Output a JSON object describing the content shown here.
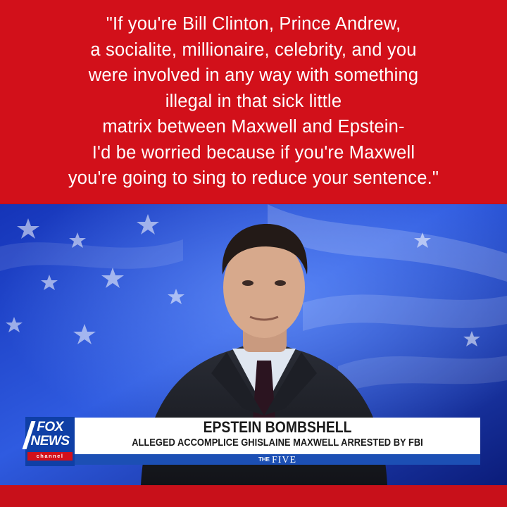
{
  "quote": {
    "text": "\"If you're Bill Clinton, Prince Andrew,\na socialite, millionaire, celebrity, and you\nwere involved in any way with something\nillegal in that sick little\nmatrix between Maxwell and Epstein-\nI'd be worried because if you're Maxwell\nyou're going to sing to reduce your sentence.\""
  },
  "logo": {
    "line1": "FOX",
    "line2": "NEWS",
    "line3": "channel"
  },
  "chyron": {
    "headline": "EPSTEIN BOMBSHELL",
    "subhead": "ALLEGED ACCOMPLICE GHISLAINE MAXWELL ARRESTED BY FBI"
  },
  "show": {
    "the": "THE",
    "name": "FIVE"
  },
  "colors": {
    "quote_background": "#d2101a",
    "quote_text": "#ffffff",
    "network_blue": "#0f3fa6",
    "lower_third_white": "#ffffff",
    "show_bar_blue": "#1c4fb4"
  }
}
